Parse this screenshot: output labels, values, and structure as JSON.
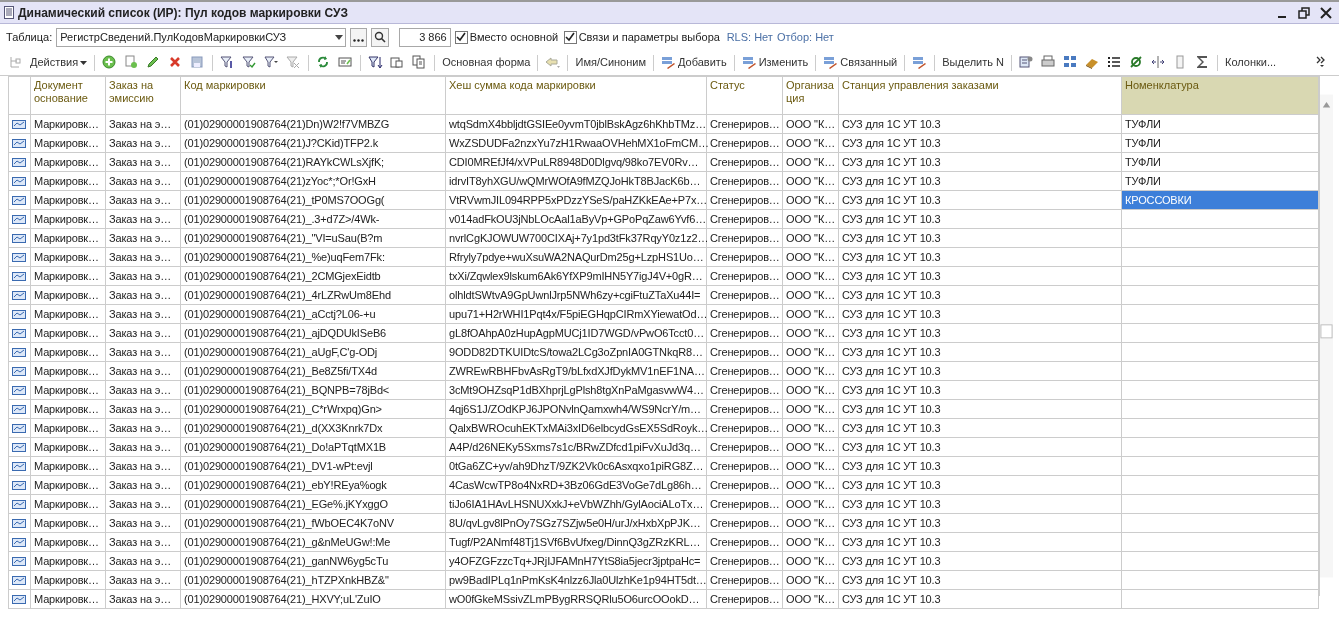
{
  "window": {
    "title": "Динамический список (ИР): Пул кодов маркировки СУЗ"
  },
  "filter_bar": {
    "table_label": "Таблица:",
    "table_value": "РегистрСведений.ПулКодовМаркировкиСУЗ",
    "count": "3 866",
    "options": [
      {
        "label": "Вместо основной",
        "checked": true
      },
      {
        "label": "Связи и параметры выбора",
        "checked": true
      }
    ],
    "rls": "RLS: Нет",
    "selection": "Отбор: Нет"
  },
  "toolbar": {
    "actions": "Действия",
    "main_form": "Основная форма",
    "name_synonym": "Имя/Синоним",
    "add": "Добавить",
    "edit": "Изменить",
    "linked": "Связанный",
    "select_n": "Выделить N",
    "columns": "Колонки..."
  },
  "table": {
    "columns": [
      {
        "label": "Документ основание",
        "highlighted": false
      },
      {
        "label": "Заказ на эмиссию",
        "highlighted": false
      },
      {
        "label": "Код маркировки",
        "highlighted": false
      },
      {
        "label": "Хеш сумма кода маркировки",
        "highlighted": false
      },
      {
        "label": "Статус",
        "highlighted": false
      },
      {
        "label": "Организа ция",
        "highlighted": false
      },
      {
        "label": "Станция управления заказами",
        "highlighted": false
      },
      {
        "label": "Номенклатура",
        "highlighted": true
      }
    ],
    "rows": [
      {
        "cells": [
          "Маркировк…",
          "Заказ на э…",
          "(01)02900001908764(21)Dn)W2!f7VMBZG",
          "wtqSdmX4bbljdtGSIEe0yvmT0jblBskAgz6hKhbTMz…",
          "Сгенериров…",
          "ООО \"К…",
          "СУЗ для 1С УТ 10.3",
          "ТУФЛИ"
        ],
        "selected": false
      },
      {
        "cells": [
          "Маркировк…",
          "Заказ на э…",
          "(01)02900001908764(21)J?CKid)TFP2.k",
          "WxZSDUDFa2nzxYu7zH1RwaaOVHehMX1oFmCM…",
          "Сгенериров…",
          "ООО \"К…",
          "СУЗ для 1С УТ 10.3",
          "ТУФЛИ"
        ],
        "selected": false
      },
      {
        "cells": [
          "Маркировк…",
          "Заказ на э…",
          "(01)02900001908764(21)RAYkCWLsXjfK;",
          "CDI0MREfJf4/xVPuLR8948D0Dlgvq/98ko7EV0Rv…",
          "Сгенериров…",
          "ООО \"К…",
          "СУЗ для 1С УТ 10.3",
          "ТУФЛИ"
        ],
        "selected": false
      },
      {
        "cells": [
          "Маркировк…",
          "Заказ на э…",
          "(01)02900001908764(21)zYoc*;*Or!GxH",
          "idrvIT8yhXGU/wQMrWOfA9fMZQJoHkT8BJacK6b…",
          "Сгенериров…",
          "ООО \"К…",
          "СУЗ для 1С УТ 10.3",
          "ТУФЛИ"
        ],
        "selected": false
      },
      {
        "cells": [
          "Маркировк…",
          "Заказ на э…",
          "(01)02900001908764(21)_tP0MS7OOGg(",
          "VtRVwmJIL094RPP5xPDzzYSeS/paHZKkEAe+P7x…",
          "Сгенериров…",
          "ООО \"К…",
          "СУЗ для 1С УТ 10.3",
          "КРОССОВКИ"
        ],
        "selected": true
      },
      {
        "cells": [
          "Маркировк…",
          "Заказ на э…",
          "(01)02900001908764(21)_.3+d7Z>/4Wk-",
          "v014adFkOU3jNbLOcAal1aByVp+GPoPqZaw6Yvf6…",
          "Сгенериров…",
          "ООО \"К…",
          "СУЗ для 1С УТ 10.3"
        ],
        "selected": false
      },
      {
        "cells": [
          "Маркировк…",
          "Заказ на э…",
          "(01)02900001908764(21)_\"VI=uSau(B?m",
          "nvrlCgKJOWUW700CIXAj+7y1pd3tFk37RqyY0z1z2…",
          "Сгенериров…",
          "ООО \"К…",
          "СУЗ для 1С УТ 10.3"
        ],
        "selected": false
      },
      {
        "cells": [
          "Маркировк…",
          "Заказ на э…",
          "(01)02900001908764(21)_%e)uqFem7Fk:",
          "Rfryly7pdye+wuXsuWA2NAQurDm25g+LzpHS1Uo…",
          "Сгенериров…",
          "ООО \"К…",
          "СУЗ для 1С УТ 10.3"
        ],
        "selected": false
      },
      {
        "cells": [
          "Маркировк…",
          "Заказ на э…",
          "(01)02900001908764(21)_2CMGjexEidtb",
          "txXi/Zqwlex9lskum6Ak6YfXP9mIHN5Y7igJ4V+0gR…",
          "Сгенериров…",
          "ООО \"К…",
          "СУЗ для 1С УТ 10.3"
        ],
        "selected": false
      },
      {
        "cells": [
          "Маркировк…",
          "Заказ на э…",
          "(01)02900001908764(21)_4rLZRwUm8Ehd",
          "olhldtSWtvA9GpUwnlJrp5NWh6zy+cgiFtuZTaXu44I=",
          "Сгенериров…",
          "ООО \"К…",
          "СУЗ для 1С УТ 10.3"
        ],
        "selected": false
      },
      {
        "cells": [
          "Маркировк…",
          "Заказ на э…",
          "(01)02900001908764(21)_aCctj?L06-+u",
          "upu71+H2rWHI1Pqt4x/F5piEGHqpCIRmXYiewatOd…",
          "Сгенериров…",
          "ООО \"К…",
          "СУЗ для 1С УТ 10.3"
        ],
        "selected": false
      },
      {
        "cells": [
          "Маркировк…",
          "Заказ на э…",
          "(01)02900001908764(21)_ajDQDUkISeB6",
          "gL8fOAhpA0zHupAgpMUCj1ID7WGD/vPwO6Tcct0…",
          "Сгенериров…",
          "ООО \"К…",
          "СУЗ для 1С УТ 10.3"
        ],
        "selected": false
      },
      {
        "cells": [
          "Маркировк…",
          "Заказ на э…",
          "(01)02900001908764(21)_aUgF,C'g-ODj",
          "9ODD82DTKUIDtcS/towa2LCg3oZpnIA0GTNkqR8…",
          "Сгенериров…",
          "ООО \"К…",
          "СУЗ для 1С УТ 10.3"
        ],
        "selected": false
      },
      {
        "cells": [
          "Маркировк…",
          "Заказ на э…",
          "(01)02900001908764(21)_Be8Z5fi/TX4d",
          "ZWREwRBHFbvAsRgT9/bLfxdXJfDykMV1nEF1NA…",
          "Сгенериров…",
          "ООО \"К…",
          "СУЗ для 1С УТ 10.3"
        ],
        "selected": false
      },
      {
        "cells": [
          "Маркировк…",
          "Заказ на э…",
          "(01)02900001908764(21)_BQNPB=78jBd<",
          "3cMt9OHZsqP1dBXhprjLgPlsh8tgXnPaMgasvwW4…",
          "Сгенериров…",
          "ООО \"К…",
          "СУЗ для 1С УТ 10.3"
        ],
        "selected": false
      },
      {
        "cells": [
          "Маркировк…",
          "Заказ на э…",
          "(01)02900001908764(21)_C*rWrxpq)Gn>",
          "4qj6S1J/ZOdKPJ6JPONvlnQamxwh4/WS9NcrY/m…",
          "Сгенериров…",
          "ООО \"К…",
          "СУЗ для 1С УТ 10.3"
        ],
        "selected": false
      },
      {
        "cells": [
          "Маркировк…",
          "Заказ на э…",
          "(01)02900001908764(21)_d(XX3Knrk7Dx",
          "QalxBWROcuhEKTxMAi3xID6elbcydGsEX5SdRoyk…",
          "Сгенериров…",
          "ООО \"К…",
          "СУЗ для 1С УТ 10.3"
        ],
        "selected": false
      },
      {
        "cells": [
          "Маркировк…",
          "Заказ на э…",
          "(01)02900001908764(21)_Do!aPTqtMX1B",
          "A4P/d26NEKy5Sxms7s1c/BRwZDfcd1piFvXuJd3q…",
          "Сгенериров…",
          "ООО \"К…",
          "СУЗ для 1С УТ 10.3"
        ],
        "selected": false
      },
      {
        "cells": [
          "Маркировк…",
          "Заказ на э…",
          "(01)02900001908764(21)_DV1-wPt:evjl",
          "0tGa6ZC+yv/ah9DhzT/9ZK2Vk0c6Asxqxo1piRG8Z…",
          "Сгенериров…",
          "ООО \"К…",
          "СУЗ для 1С УТ 10.3"
        ],
        "selected": false
      },
      {
        "cells": [
          "Маркировк…",
          "Заказ на э…",
          "(01)02900001908764(21)_ebY!REya%ogk",
          "4CasWcwTP8o4NxRD+3Bz06GdE3VoGe7dLg86h…",
          "Сгенериров…",
          "ООО \"К…",
          "СУЗ для 1С УТ 10.3"
        ],
        "selected": false
      },
      {
        "cells": [
          "Маркировк…",
          "Заказ на э…",
          "(01)02900001908764(21)_EGe%.jKYxggO",
          "tiJo6IA1HAvLHSNUXxkJ+eVbWZhh/GylAociALoTx…",
          "Сгенериров…",
          "ООО \"К…",
          "СУЗ для 1С УТ 10.3"
        ],
        "selected": false
      },
      {
        "cells": [
          "Маркировк…",
          "Заказ на э…",
          "(01)02900001908764(21)_fWbOEC4K7oNV",
          "8U/qvLgv8lPnOy7SGz7SZjw5e0H/urJ/xHxbXpPJK…",
          "Сгенериров…",
          "ООО \"К…",
          "СУЗ для 1С УТ 10.3"
        ],
        "selected": false
      },
      {
        "cells": [
          "Маркировк…",
          "Заказ на э…",
          "(01)02900001908764(21)_g&nMeUGw!:Me",
          "Tugf/P2ANmf48Tj1SVf6BvUfxeg/DinnQ3gZRzKRL…",
          "Сгенериров…",
          "ООО \"К…",
          "СУЗ для 1С УТ 10.3"
        ],
        "selected": false
      },
      {
        "cells": [
          "Маркировк…",
          "Заказ на э…",
          "(01)02900001908764(21)_ganNW6yg5cTu",
          "y4OFZGFzzcTq+JRjIJFAMnH7YtS8ia5jecr3jptpaHc=",
          "Сгенериров…",
          "ООО \"К…",
          "СУЗ для 1С УТ 10.3"
        ],
        "selected": false
      },
      {
        "cells": [
          "Маркировк…",
          "Заказ на э…",
          "(01)02900001908764(21)_hTZPXnkHBZ&\"",
          "pw9BadIPLq1nPmKsK4nlzz6Jla0UlzhKe1p94HT5dt…",
          "Сгенериров…",
          "ООО \"К…",
          "СУЗ для 1С УТ 10.3"
        ],
        "selected": false
      },
      {
        "cells": [
          "Маркировк…",
          "Заказ на э…",
          "(01)02900001908764(21)_HXVY;uL'ZuIO",
          "wO0fGkeMSsivZLmPBygRRSQRlu5O6urcOOokD…",
          "Сгенериров…",
          "ООО \"К…",
          "СУЗ для 1С УТ 10.3"
        ],
        "selected": false
      }
    ]
  }
}
